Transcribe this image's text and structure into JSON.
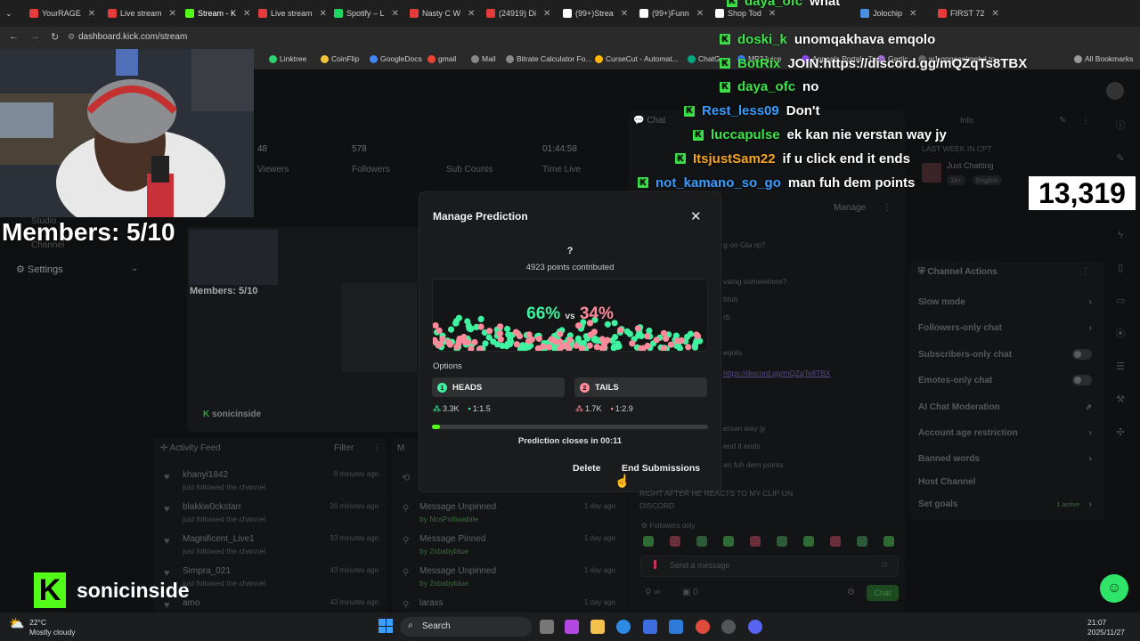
{
  "browser": {
    "tabs": [
      {
        "label": "YourRAGE",
        "color": "#e53b3b"
      },
      {
        "label": "Live stream",
        "color": "#e53b3b"
      },
      {
        "label": "Stream - K",
        "color": "#53fc18",
        "active": true
      },
      {
        "label": "Live stream",
        "color": "#e53b3b"
      },
      {
        "label": "Spotify – L",
        "color": "#1ed760"
      },
      {
        "label": "Nasty C W",
        "color": "#e53b3b"
      },
      {
        "label": "(24919) Di",
        "color": "#e53b3b"
      },
      {
        "label": "(99+)Strea",
        "color": "#ffffff"
      },
      {
        "label": "(99+)Funn",
        "color": "#ffffff"
      },
      {
        "label": "Shop Tod",
        "color": "#ffffff"
      },
      {
        "label": "Jolochip",
        "color": "#4a90e2"
      },
      {
        "label": "FIRST 72",
        "color": "#e53b3b"
      }
    ],
    "url": "dashboard.kick.com/stream",
    "bookmarks": [
      "Linktree",
      "CoinFlip",
      "GoogleDocs",
      "gmail",
      "Mail",
      "Bitrate Calculator Fo...",
      "CurseCut - Automat...",
      "ChatG",
      "MP3Juice",
      "Appeals Portal - Twi...",
      "Gartic",
      "w1.gogoanimehd.to",
      "All Bookmarks"
    ]
  },
  "dashboard": {
    "stats": [
      {
        "value": "48",
        "label": "Viewers"
      },
      {
        "value": "578",
        "label": "Followers"
      },
      {
        "value": "",
        "label": "Sub Counts"
      },
      {
        "value": "01:44:58",
        "label": "Time Live"
      }
    ],
    "nav": {
      "studio": "Studio",
      "channel": "Channel",
      "settings": "Settings"
    },
    "chat_title": "Chat",
    "info": "Info",
    "manage": "Manage",
    "stream_info": {
      "category": "Just Chatting",
      "tags": [
        "18+",
        "English"
      ],
      "week": "LAST WEEK IN CPT"
    },
    "activity": {
      "title": "Activity Feed",
      "filter": "Filter",
      "items": [
        {
          "name": "khanyi1842",
          "sub": "just followed the channel",
          "time": "8 minutes ago"
        },
        {
          "name": "blakkw0ckstarr",
          "sub": "just followed the channel",
          "time": "26 minutes ago"
        },
        {
          "name": "Magnificent_Live1",
          "sub": "just followed the channel",
          "time": "33 minutes ago"
        },
        {
          "name": "Simpra_021",
          "sub": "just followed the channel",
          "time": "43 minutes ago"
        },
        {
          "name": "amo",
          "sub": "",
          "time": "43 minutes ago"
        }
      ]
    },
    "moderation": {
      "items": [
        {
          "title": "Message Unpinned",
          "by": "by NcsPolliwabile",
          "time": "1 day ago"
        },
        {
          "title": "Message Pinned",
          "by": "by 2xbabyblue",
          "time": "1 day ago"
        },
        {
          "title": "Message Unpinned",
          "by": "by 2xbabyblue",
          "time": "1 day ago"
        },
        {
          "title": "laraxs",
          "by": "",
          "time": "1 day ago"
        }
      ]
    },
    "chat_bg": [
      "g on Gta rp?",
      "vaing somewhere?",
      "btuh",
      "rb",
      "eqolo",
      "https://discord.gg/mQZqTs8TBX",
      "ersan way jy",
      "end it ends",
      "an fuh dem points",
      "RIGHT AFTER HE REACTS TO MY CLIP ON",
      "DISCORD"
    ],
    "followers_only": "Followers only",
    "send_placeholder": "Send a message",
    "chat_button": "Chat",
    "chat_counts": {
      "viewers": "0"
    },
    "channel_actions": {
      "title": "Channel Actions",
      "items": [
        {
          "label": "Slow mode",
          "kind": "chev"
        },
        {
          "label": "Followers-only chat",
          "kind": "chev"
        },
        {
          "label": "Subscribers-only chat",
          "kind": "toggle"
        },
        {
          "label": "Emotes-only chat",
          "kind": "toggle"
        },
        {
          "label": "AI Chat Moderation",
          "kind": "ext"
        },
        {
          "label": "Account age restriction",
          "kind": "chev"
        },
        {
          "label": "Banned words",
          "kind": "chev"
        },
        {
          "label": "Host Channel",
          "kind": "none"
        },
        {
          "label": "Set goals",
          "kind": "chev",
          "badge": "1 active"
        }
      ]
    }
  },
  "overlay": {
    "members": "Members: 5/10",
    "members_small": "Members: 5/10",
    "sonic_small": "sonicinside",
    "brand": "sonicinside",
    "counter": "13,319",
    "chat": [
      {
        "user": "daya_ofc",
        "msg": "what",
        "color": "#3ee34a"
      },
      {
        "user": "doski_k",
        "msg": "unomqakhava emqolo",
        "color": "#3ee34a"
      },
      {
        "user": "BotRix",
        "msg": "JOIN:https://discord.gg/mQZqTs8TBX",
        "color": "#3ee34a"
      },
      {
        "user": "daya_ofc",
        "msg": "no",
        "color": "#3ee34a"
      },
      {
        "user": "Rest_less09",
        "msg": "Don't",
        "color": "#3b9cff"
      },
      {
        "user": "luccapulse",
        "msg": "ek kan nie verstan way jy",
        "color": "#3ee34a"
      },
      {
        "user": "ItsjustSam22",
        "msg": "if u click end it ends",
        "color": "#f5a623"
      },
      {
        "user": "not_kamano_so_go",
        "msg": "man fuh dem points",
        "color": "#3b9cff"
      }
    ]
  },
  "modal": {
    "title": "Manage Prediction",
    "question": "?",
    "points": "4923 points contributed",
    "percent_a": "66%",
    "vs": "vs",
    "percent_b": "34%",
    "color_a": "#3ef2a0",
    "color_b": "#ff8a9a",
    "options_label": "Options",
    "options": [
      {
        "num": "1",
        "label": "HEADS",
        "users": "3.3K",
        "ratio": "1:1.5"
      },
      {
        "num": "2",
        "label": "TAILS",
        "users": "1.7K",
        "ratio": "1:2.9"
      }
    ],
    "progress": 0.03,
    "closes_prefix": "Prediction closes in",
    "closes_time": "00:11",
    "delete_label": "Delete",
    "end_label": "End Submissions"
  },
  "taskbar": {
    "temp": "22°C",
    "weather": "Mostly cloudy",
    "search": "Search",
    "time": "21:07",
    "date": "2025/11/27"
  }
}
